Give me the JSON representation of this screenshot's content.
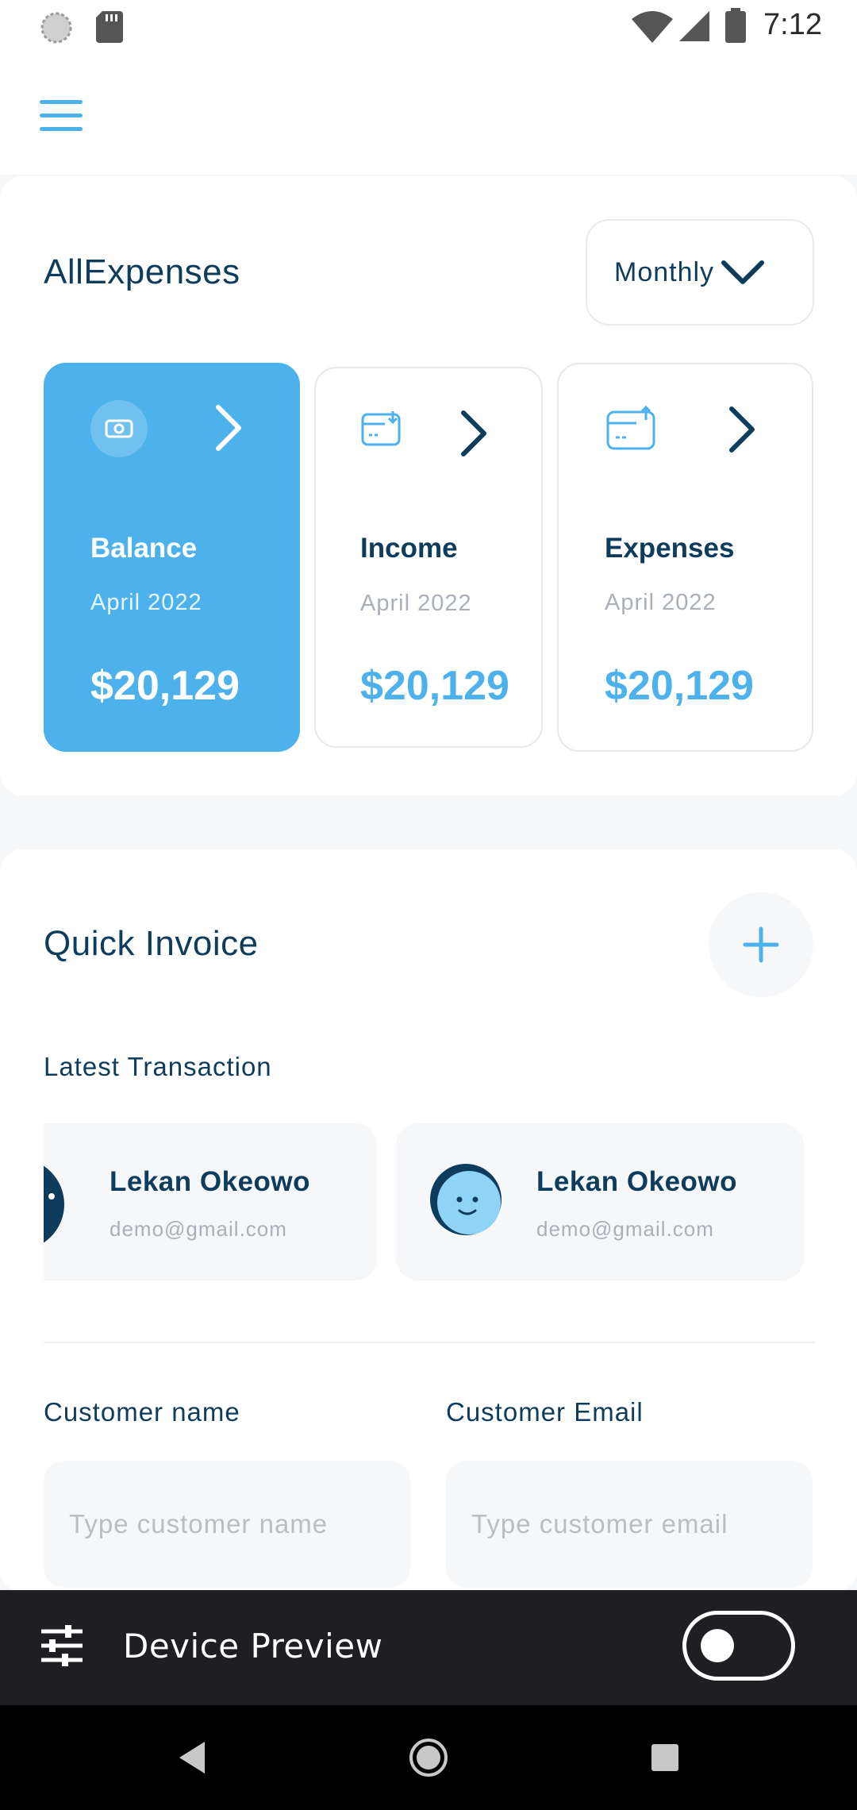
{
  "status_bar": {
    "time": "7:12"
  },
  "expenses": {
    "title": "AllExpenses",
    "period_label": "Monthly",
    "cards": [
      {
        "name": "Balance",
        "date": "April 2022",
        "amount": "$20,129"
      },
      {
        "name": "Income",
        "date": "April 2022",
        "amount": "$20,129"
      },
      {
        "name": "Expenses",
        "date": "April 2022",
        "amount": "$20,129"
      }
    ]
  },
  "invoice": {
    "title": "Quick Invoice",
    "latest_label": "Latest Transaction",
    "transactions": [
      {
        "name": "Lekan Okeowo",
        "email": "demo@gmail.com"
      },
      {
        "name": "Lekan Okeowo",
        "email": "demo@gmail.com"
      }
    ],
    "customer_name_label": "Customer name",
    "customer_name_placeholder": "Type customer name",
    "customer_email_label": "Customer Email",
    "customer_email_placeholder": "Type customer email"
  },
  "device_preview": {
    "label": "Device Preview",
    "enabled": false
  },
  "colors": {
    "accent": "#4db2ec",
    "navy": "#0e3c5c",
    "muted": "#a9b0b8"
  }
}
